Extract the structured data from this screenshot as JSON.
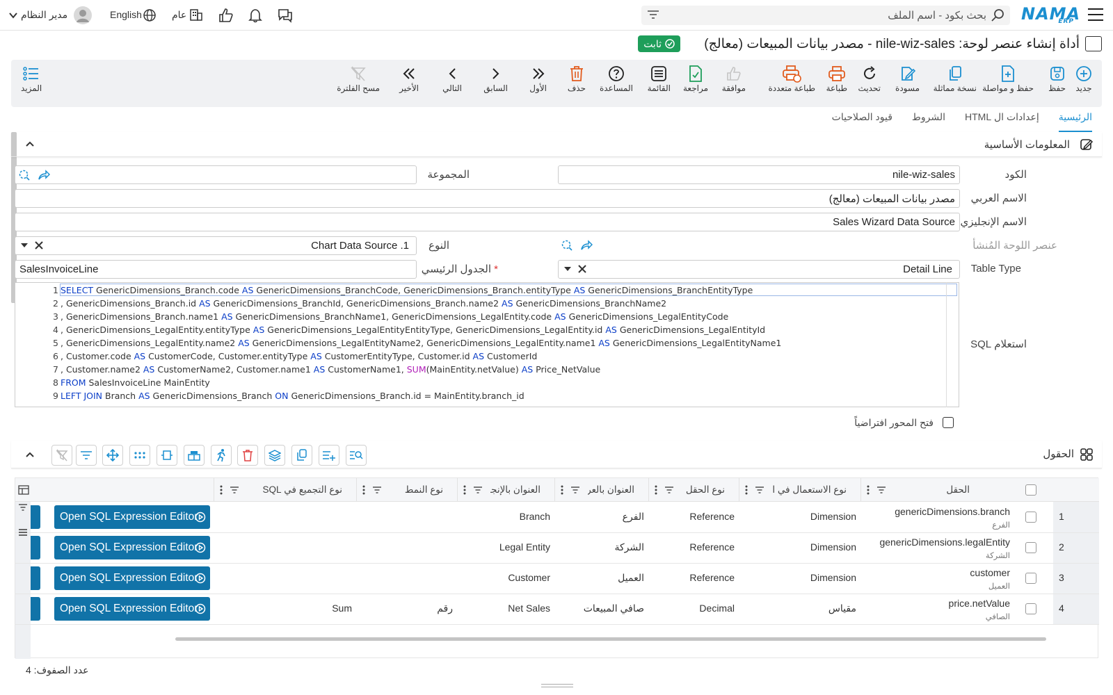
{
  "topbar": {
    "logo": "NAMA",
    "logo_sub": "ERP",
    "search_placeholder": "بحث بكود - اسم الملف",
    "user": "مدير النظام",
    "language": "English",
    "scope": "عام"
  },
  "title": {
    "text": "أداة إنشاء عنصر لوحة: nile-wiz-sales - مصدر بيانات المبيعات (معالج)",
    "status_badge": "ثابت"
  },
  "toolbar": {
    "new": "جديد",
    "save": "حفظ",
    "save_continue": "حفظ و مواصلة",
    "duplicate": "نسخة مماثلة",
    "draft": "مسودة",
    "refresh": "تحديث",
    "print": "طباعة",
    "multi_print": "طباعة متعددة",
    "approve": "موافقة",
    "review": "مراجعة",
    "list": "القائمة",
    "help": "المساعدة",
    "delete": "حذف",
    "first": "الأول",
    "previous": "السابق",
    "next": "التالي",
    "last": "الأخير",
    "clear_filter": "مسح الفلترة",
    "more": "المزيد"
  },
  "tabs": [
    "الرئيسية",
    "إعدادات ال HTML",
    "الشروط",
    "قيود الصلاحيات"
  ],
  "section": {
    "title": "المعلومات الأساسية"
  },
  "form": {
    "code_label": "الكود",
    "code_value": "nile-wiz-sales",
    "group_label": "المجموعة",
    "arabic_name_label": "الاسم العربي",
    "arabic_name_value": "مصدر بيانات المبيعات (معالج)",
    "english_name_label": "الاسم الإنجليزي",
    "english_name_value": "Sales Wizard Data Source",
    "created_element_label": "عنصر اللوحة المُنشأ",
    "type_label": "النوع",
    "type_value": "1. Chart Data Source",
    "table_type_label": "Table Type",
    "table_type_value": "Detail Line",
    "main_table_label": "الجدول الرئيسي",
    "main_table_value": "SalesInvoiceLine",
    "sql_label": "استعلام SQL",
    "open_axis_label": "فتح المحور افتراضياً"
  },
  "sql_lines": [
    [
      [
        "kw",
        "SELECT"
      ],
      [
        "t",
        " GenericDimensions_Branch.code "
      ],
      [
        "kw",
        "AS"
      ],
      [
        "t",
        " GenericDimensions_BranchCode, GenericDimensions_Branch.entityType "
      ],
      [
        "kw",
        "AS"
      ],
      [
        "t",
        " GenericDimensions_BranchEntityType"
      ]
    ],
    [
      [
        "t",
        ", GenericDimensions_Branch.id "
      ],
      [
        "kw",
        "AS"
      ],
      [
        "t",
        " GenericDimensions_BranchId, GenericDimensions_Branch.name2 "
      ],
      [
        "kw",
        "AS"
      ],
      [
        "t",
        " GenericDimensions_BranchName2"
      ]
    ],
    [
      [
        "t",
        ", GenericDimensions_Branch.name1 "
      ],
      [
        "kw",
        "AS"
      ],
      [
        "t",
        " GenericDimensions_BranchName1, GenericDimensions_LegalEntity.code "
      ],
      [
        "kw",
        "AS"
      ],
      [
        "t",
        " GenericDimensions_LegalEntityCode"
      ]
    ],
    [
      [
        "t",
        ", GenericDimensions_LegalEntity.entityType "
      ],
      [
        "kw",
        "AS"
      ],
      [
        "t",
        " GenericDimensions_LegalEntityEntityType, GenericDimensions_LegalEntity.id "
      ],
      [
        "kw",
        "AS"
      ],
      [
        "t",
        " GenericDimensions_LegalEntityId"
      ]
    ],
    [
      [
        "t",
        ", GenericDimensions_LegalEntity.name2 "
      ],
      [
        "kw",
        "AS"
      ],
      [
        "t",
        " GenericDimensions_LegalEntityName2, GenericDimensions_LegalEntity.name1 "
      ],
      [
        "kw",
        "AS"
      ],
      [
        "t",
        " GenericDimensions_LegalEntityName1"
      ]
    ],
    [
      [
        "t",
        ", Customer.code "
      ],
      [
        "kw",
        "AS"
      ],
      [
        "t",
        " CustomerCode, Customer.entityType "
      ],
      [
        "kw",
        "AS"
      ],
      [
        "t",
        " CustomerEntityType, Customer.id "
      ],
      [
        "kw",
        "AS"
      ],
      [
        "t",
        " CustomerId"
      ]
    ],
    [
      [
        "t",
        ", Customer.name2 "
      ],
      [
        "kw",
        "AS"
      ],
      [
        "t",
        " CustomerName2, Customer.name1 "
      ],
      [
        "kw",
        "AS"
      ],
      [
        "t",
        " CustomerName1, "
      ],
      [
        "fn",
        "SUM"
      ],
      [
        "t",
        "(MainEntity.netValue) "
      ],
      [
        "kw",
        "AS"
      ],
      [
        "t",
        " Price_NetValue"
      ]
    ],
    [
      [
        "kw",
        "FROM"
      ],
      [
        "t",
        " SalesInvoiceLine MainEntity"
      ]
    ],
    [
      [
        "kw",
        "LEFT JOIN"
      ],
      [
        "t",
        " Branch "
      ],
      [
        "kw",
        "AS"
      ],
      [
        "t",
        " GenericDimensions_Branch "
      ],
      [
        "kw",
        "ON"
      ],
      [
        "t",
        " GenericDimensions_Branch.id = MainEntity.branch_id"
      ]
    ]
  ],
  "fields_section": {
    "title": "الحقول"
  },
  "grid": {
    "columns": [
      "الحقل",
      "نوع الاستعمال في الرسم",
      "نوع الحقل",
      "العنوان بالعربية",
      "العنوان بالإنجليزية",
      "نوع النمط",
      "نوع التجميع في SQL"
    ],
    "rows": [
      {
        "num": "1",
        "field": "genericDimensions.branch",
        "field_sub": "الفرع",
        "usage": "Dimension",
        "ftype": "Reference",
        "ar": "الفرع",
        "en": "Branch",
        "style": "",
        "agg": "",
        "btn": "Open SQL Expression Editor"
      },
      {
        "num": "2",
        "field": "genericDimensions.legalEntity",
        "field_sub": "الشركة",
        "usage": "Dimension",
        "ftype": "Reference",
        "ar": "الشركة",
        "en": "Legal Entity",
        "style": "",
        "agg": "",
        "btn": "Open SQL Expression Editor"
      },
      {
        "num": "3",
        "field": "customer",
        "field_sub": "العميل",
        "usage": "Dimension",
        "ftype": "Reference",
        "ar": "العميل",
        "en": "Customer",
        "style": "",
        "agg": "",
        "btn": "Open SQL Expression Editor"
      },
      {
        "num": "4",
        "field": "price.netValue",
        "field_sub": "الصافي",
        "usage": "مقياس",
        "ftype": "Decimal",
        "ar": "صافي المبيعات",
        "en": "Net Sales",
        "style": "رقم",
        "agg": "Sum",
        "btn": "Open SQL Expression Editor"
      }
    ],
    "row_count": "عدد الصفوف: 4"
  }
}
